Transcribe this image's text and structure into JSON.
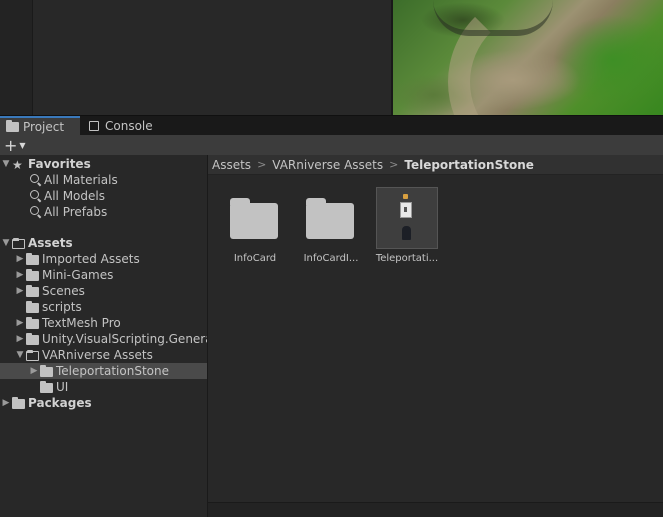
{
  "tabs": {
    "project": "Project",
    "console": "Console"
  },
  "tree": {
    "favorites": {
      "label": "Favorites",
      "items": [
        "All Materials",
        "All Models",
        "All Prefabs"
      ]
    },
    "assets": {
      "label": "Assets",
      "children": [
        "Imported Assets",
        "Mini-Games",
        "Scenes",
        "scripts",
        "TextMesh Pro",
        "Unity.VisualScripting.Genera",
        "VARniverse Assets"
      ],
      "varniverse_children": [
        "TeleportationStone",
        "UI"
      ]
    },
    "packages": {
      "label": "Packages"
    }
  },
  "breadcrumb": [
    "Assets",
    "VARniverse Assets",
    "TeleportationStone"
  ],
  "assets_grid": [
    {
      "label": "InfoCard",
      "kind": "folder"
    },
    {
      "label": "InfoCardI...",
      "kind": "folder"
    },
    {
      "label": "Teleportati...",
      "kind": "prefab"
    }
  ],
  "icons": {
    "add": "plus-icon",
    "folder": "folder-icon",
    "search": "search-icon",
    "star": "star-icon",
    "console": "console-icon"
  },
  "colors": {
    "accent": "#3a79bb",
    "panel": "#282828",
    "selected_row": "#4a4a4a"
  }
}
